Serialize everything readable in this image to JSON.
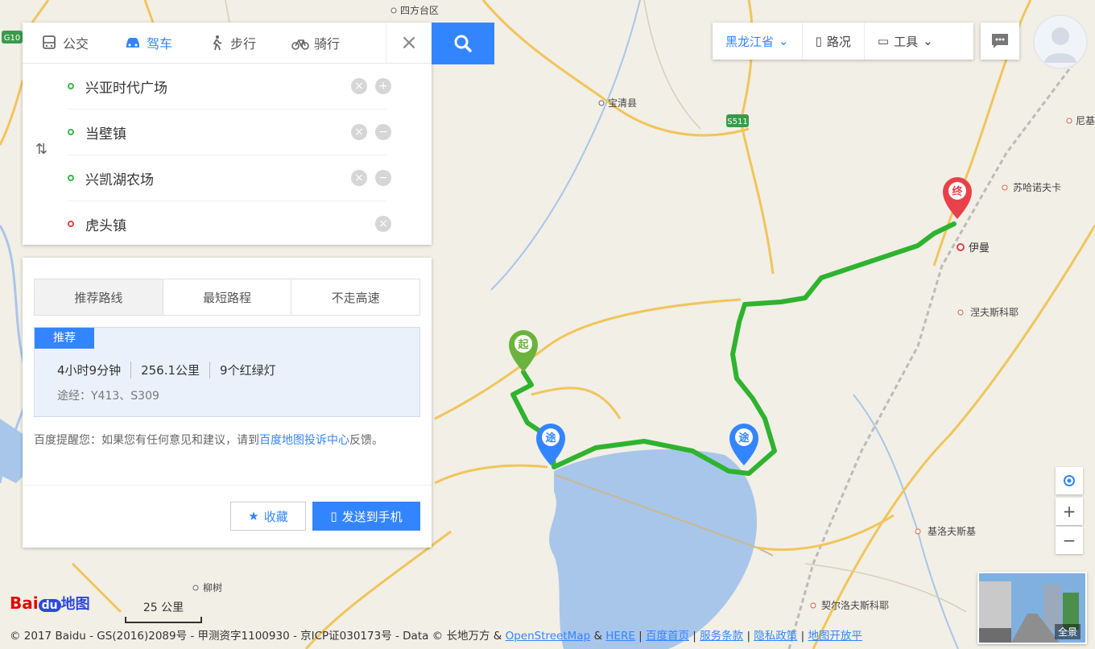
{
  "mode_tabs": [
    {
      "label": "公交",
      "icon": "bus-icon"
    },
    {
      "label": "驾车",
      "icon": "car-icon",
      "active": true
    },
    {
      "label": "步行",
      "icon": "walk-icon"
    },
    {
      "label": "骑行",
      "icon": "bike-icon"
    }
  ],
  "stops": [
    {
      "name": "兴亚时代广场",
      "type": "start"
    },
    {
      "name": "当壁镇",
      "type": "via"
    },
    {
      "name": "兴凯湖农场",
      "type": "via"
    },
    {
      "name": "虎头镇",
      "type": "end"
    }
  ],
  "result": {
    "tabs": [
      "推荐路线",
      "最短路程",
      "不走高速"
    ],
    "badge": "推荐",
    "duration": "4小时9分钟",
    "distance": "256.1公里",
    "lights": "9个红绿灯",
    "via": "途经：Y413、S309",
    "tip_prefix": "百度提醒您：如果您有任何意见和建议，请到",
    "tip_link": "百度地图投诉中心",
    "tip_suffix": "反馈。",
    "fav_label": "收藏",
    "send_label": "发送到手机"
  },
  "toolbar": {
    "city": "黑龙江省",
    "traffic": "路况",
    "tools": "工具"
  },
  "map_labels": {
    "sifangtai": "四方台区",
    "baoqing": "宝清县",
    "g10": "G10",
    "s511": "S511",
    "suhe": "苏哈诺夫卡",
    "yiman": "伊曼",
    "lazhefu": "涅夫斯科耶",
    "jiluo": "基洛夫斯基",
    "liushu": "柳树",
    "nifu": "尼基",
    "bottom_town": "契尔洛夫斯科耶",
    "pin_start": "起",
    "pin_end": "终",
    "pin_via": "途"
  },
  "logo": {
    "bai": "Bai",
    "du": "du",
    "map": "地图"
  },
  "scale": "25 公里",
  "copyright": {
    "text": "© 2017 Baidu - GS(2016)2089号 - 甲测资字1100930 - 京ICP证030173号 - Data © 长地万方 & ",
    "osm": "OpenStreetMap",
    "amp": " & ",
    "here": "HERE",
    "links": [
      "百度首页",
      "服务条款",
      "隐私政策",
      "地图开放平"
    ]
  },
  "panorama_label": "全景",
  "colors": {
    "accent": "#3385ff",
    "route": "#2fb32f",
    "water": "#a8c6ea",
    "road": "#f3c460"
  }
}
